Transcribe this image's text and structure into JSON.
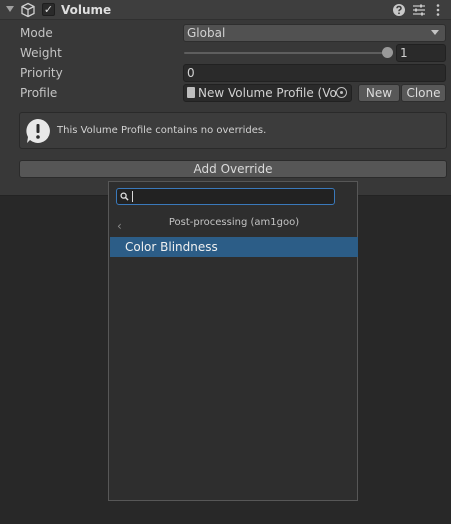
{
  "component": {
    "title": "Volume",
    "enabled_check": "✓",
    "icons": [
      "foldout-arrow",
      "cube-icon",
      "help-icon",
      "presets-icon",
      "more-options-icon"
    ]
  },
  "fields": {
    "mode": {
      "label": "Mode",
      "value": "Global",
      "options_visible": [
        "Global"
      ]
    },
    "weight": {
      "label": "Weight",
      "value": "1",
      "slider_fraction": 1.0
    },
    "priority": {
      "label": "Priority",
      "value": "0"
    },
    "profile": {
      "label": "Profile",
      "value": "New Volume Profile (Vo",
      "new_label": "New",
      "clone_label": "Clone"
    }
  },
  "help": {
    "text": "This Volume Profile contains no overrides."
  },
  "add_override": {
    "label": "Add Override"
  },
  "popup": {
    "search_value": "",
    "back_glyph": "‹",
    "section_title": "Post-processing (am1goo)",
    "items": [
      {
        "label": "Color Blindness",
        "selected": true
      }
    ]
  },
  "colors": {
    "selection": "#2c5d87",
    "focus": "#3a79bb",
    "panel": "#383838"
  }
}
